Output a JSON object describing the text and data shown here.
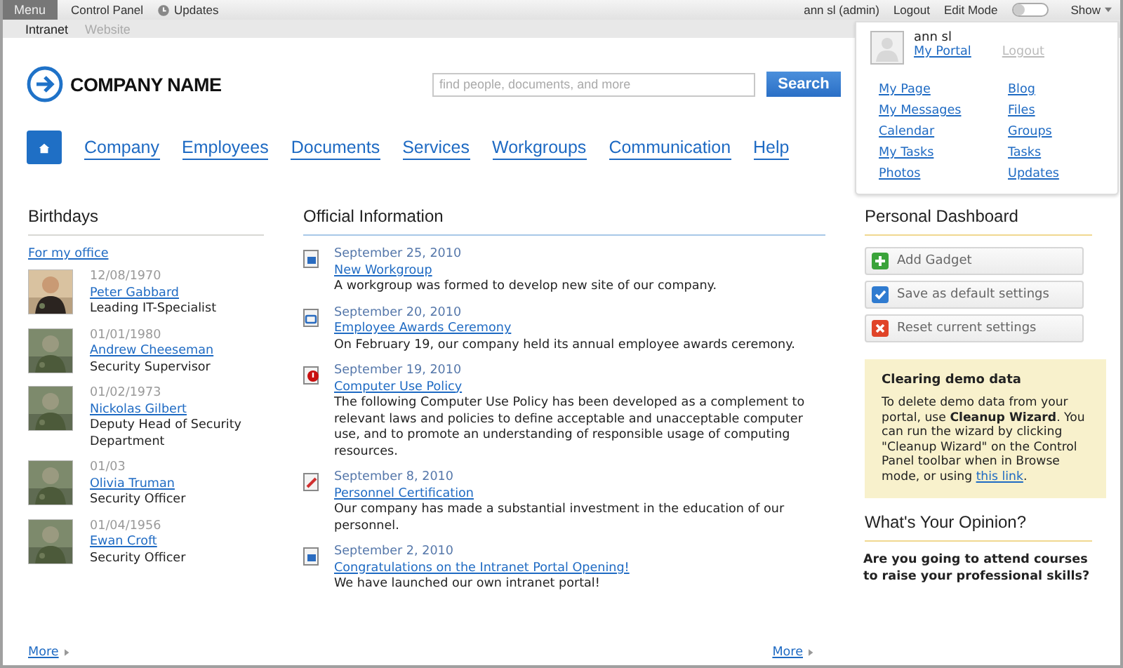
{
  "top_bar": {
    "menu": "Menu",
    "links": [
      {
        "label": "Control Panel",
        "kind": "plain"
      },
      {
        "label": "Updates",
        "kind": "updates"
      }
    ],
    "user": "ann sl (admin)",
    "logout": "Logout",
    "edit_mode": {
      "label": "Edit Mode",
      "on": false
    },
    "show": "Show"
  },
  "site_tabs": [
    {
      "label": "Intranet",
      "selected": true
    },
    {
      "label": "Website",
      "selected": false
    }
  ],
  "logo": "COMPANY NAME",
  "search": {
    "placeholder": "find people, documents, and more",
    "button": "Search"
  },
  "nav": [
    "Company",
    "Employees",
    "Documents",
    "Services",
    "Workgroups",
    "Communication",
    "Help"
  ],
  "user_popup": {
    "name": "ann sl",
    "portal": "My Portal",
    "logout": "Logout",
    "links_left": [
      "My Page",
      "My Messages",
      "Calendar",
      "My Tasks",
      "Photos"
    ],
    "links_right": [
      "Blog",
      "Files",
      "Groups",
      "Tasks",
      "Updates"
    ]
  },
  "birthdays": {
    "title": "Birthdays",
    "filter": "For my office",
    "people": [
      {
        "date": "12/08/1970",
        "name": "Peter Gabbard",
        "position": "Leading IT-Specialist",
        "kind": "picture"
      },
      {
        "date": "01/01/1980",
        "name": "Andrew Cheeseman",
        "position": "Security Supervisor",
        "kind": "picture"
      },
      {
        "date": "01/02/1973",
        "name": "Nickolas Gilbert",
        "position": "Deputy Head of Security Department",
        "kind": "picture"
      },
      {
        "date": "01/03",
        "name": "Olivia Truman",
        "position": "Security Officer",
        "kind": "picture"
      },
      {
        "date": "01/04/1956",
        "name": "Ewan Croft",
        "position": "Security Officer",
        "kind": "picture"
      }
    ],
    "more": "More"
  },
  "official": {
    "title": "Official Information",
    "items": [
      {
        "kind": "doc",
        "date": "September 25, 2010",
        "title": "New Workgroup",
        "text": "A workgroup was formed to develop new site of our company."
      },
      {
        "kind": "event",
        "date": "September 20, 2010",
        "title": "Employee Awards Ceremony",
        "text": "On February 19, our company held its annual employee awards ceremony."
      },
      {
        "kind": "alert",
        "date": "September 19, 2010",
        "title": "Computer Use Policy",
        "text": "The following Computer Use Policy has been developed as a complement to relevant laws and policies to define acceptable and unacceptable computer use, and to promote an understanding of responsible usage of computing resources."
      },
      {
        "kind": "cert",
        "date": "September 8, 2010",
        "title": "Personnel Certification",
        "text": "Our company has made a substantial investment in the education of our personnel."
      },
      {
        "kind": "doc",
        "date": "September 2, 2010",
        "title": "Congratulations on the Intranet Portal Opening!",
        "text": "We have launched our own intranet portal!"
      }
    ],
    "more": "More"
  },
  "dashboard": {
    "title": "Personal Dashboard",
    "buttons": [
      {
        "kind": "add",
        "label": "Add Gadget"
      },
      {
        "kind": "save",
        "label": "Save as default settings"
      },
      {
        "kind": "reset",
        "label": "Reset current settings"
      }
    ],
    "notice": {
      "title": "Clearing demo data",
      "text": "To delete demo data from your portal, use **Cleanup Wizard**. You can run the wizard by clicking \"Cleanup Wizard\" on the Control Panel toolbar when in Browse mode, or using",
      "link": "this link",
      "after": "."
    },
    "poll_title": "What's Your Opinion?",
    "poll_question": "Are you going to attend courses to raise your professional skills?"
  }
}
